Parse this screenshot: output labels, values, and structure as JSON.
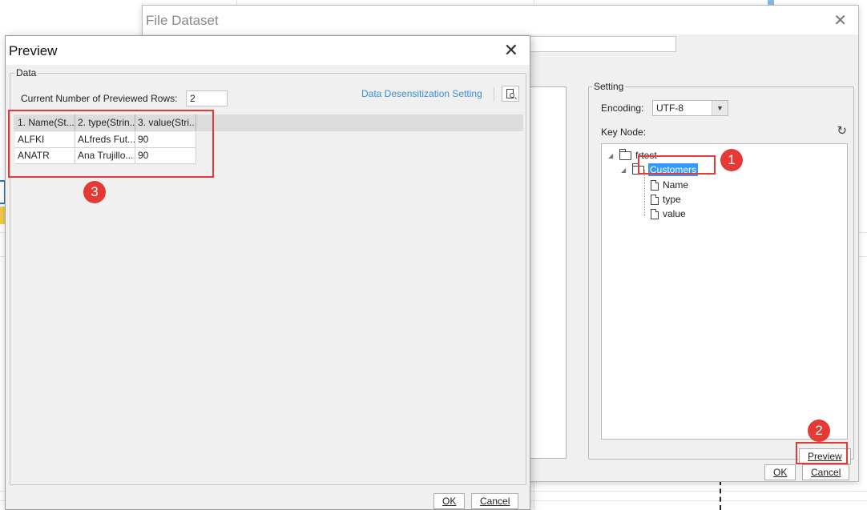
{
  "file_dataset": {
    "title": "File Dataset",
    "setting_legend": "Setting",
    "encoding_label": "Encoding:",
    "encoding_value": "UTF-8",
    "key_node_label": "Key Node:",
    "tree": {
      "root": "frtest",
      "selected": "Customers",
      "children": [
        "Name",
        "type",
        "value"
      ]
    },
    "preview_button": "Preview",
    "ok_button": "OK",
    "cancel_button": "Cancel"
  },
  "preview": {
    "title": "Preview",
    "data_legend": "Data",
    "rows_label": "Current Number of Previewed Rows:",
    "rows_value": "2",
    "desensitization_link": "Data Desensitization Setting",
    "columns": [
      "1. Name(St...",
      "2. type(Strin...",
      "3. value(Stri..."
    ],
    "rows": [
      [
        "ALFKI",
        "ALfreds Fut...",
        "90"
      ],
      [
        "ANATR",
        "Ana Trujillo...",
        "90"
      ]
    ],
    "ok_button": "OK",
    "cancel_button": "Cancel"
  },
  "annotations": [
    "1",
    "2",
    "3"
  ],
  "colors": {
    "highlight": "#e53935",
    "selection": "#3399ff",
    "link": "#3a8fd6"
  }
}
